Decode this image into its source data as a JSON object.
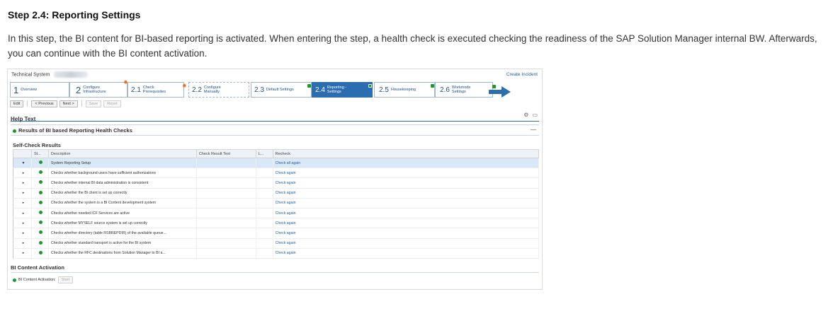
{
  "doc": {
    "title": "Step 2.4: Reporting Settings",
    "paragraph": "In this step, the BI content for BI-based reporting is activated. When entering the step, a health check is executed checking the readiness of the SAP Solution Manager internal BW. Afterwards, you can continue with the BI content activation."
  },
  "header": {
    "technical_system_label": "Technical System",
    "create_incident": "Create Incident"
  },
  "roadmap": {
    "steps": [
      {
        "num": "1",
        "label": "Overview"
      },
      {
        "num": "2",
        "label": "Configure Infrastructure"
      },
      {
        "num": "2.1",
        "label": "Check Prerequisites"
      },
      {
        "num": "2.2",
        "label": "Configure Manually"
      },
      {
        "num": "2.3",
        "label": "Default Settings"
      },
      {
        "num": "2.4",
        "label": "Reporting - Settings"
      },
      {
        "num": "2.5",
        "label": "Housekeeping"
      },
      {
        "num": "2.6",
        "label": "Workmode Settings"
      }
    ]
  },
  "toolbar": {
    "edit": "Edit",
    "previous": "< Previous",
    "next": "Next >",
    "save": "Save",
    "reset": "Reset"
  },
  "help": {
    "title": "Help Text"
  },
  "panel": {
    "title": "Results of BI based Reporting Health Checks"
  },
  "self_check": {
    "title": "Self-Check Results",
    "columns": [
      "St...",
      "Description",
      "Check Result Text",
      "L...",
      "Recheck"
    ],
    "rows": [
      {
        "description": "System Reporting Setup",
        "result": "",
        "recheck": "Check all again"
      },
      {
        "description": "Checks whether background users have sufficient authorizations",
        "result": "",
        "recheck": "Check again"
      },
      {
        "description": "Checks whether internal BI data administration is consistent",
        "result": "",
        "recheck": "Check again"
      },
      {
        "description": "Checks whether the BI client is set up correctly",
        "result": "",
        "recheck": "Check again"
      },
      {
        "description": "Checks whether the system is a BI Content development system",
        "result": "",
        "recheck": "Check again"
      },
      {
        "description": "Checks whether needed ICF Services are active",
        "result": "",
        "recheck": "Check again"
      },
      {
        "description": "Checks whether MYSELF source system is set up correctly",
        "result": "",
        "recheck": "Check again"
      },
      {
        "description": "Checks whether directory (table RSBREPDIR) of the available queue...",
        "result": "",
        "recheck": "Check again"
      },
      {
        "description": "Checks whether standard transport is active for the BI system",
        "result": "",
        "recheck": "Check again"
      },
      {
        "description": "Checks whether the RFC destinations from Solution Manager to BI a...",
        "result": "",
        "recheck": "Check again"
      }
    ]
  },
  "bi_content": {
    "title": "BI Content Activation",
    "label": "BI Content Activation:",
    "start": "Start"
  },
  "colors": {
    "accent": "#2a6db1",
    "status_ok": "#1a9a2a",
    "link": "#1f5fa8"
  }
}
